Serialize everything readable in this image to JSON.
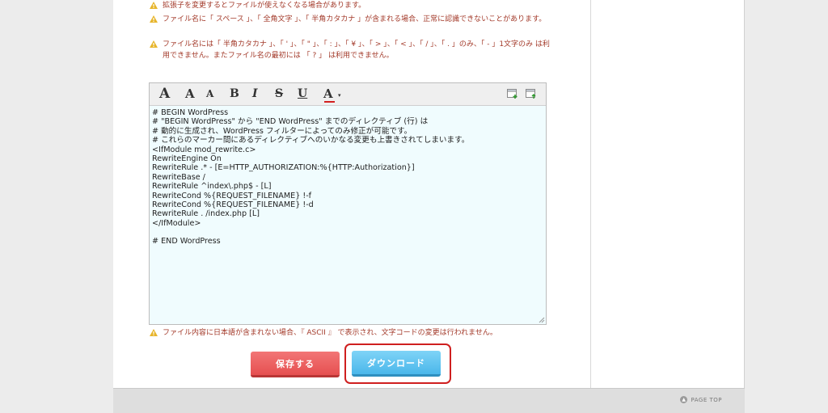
{
  "notes": [
    "拡張子を変更するとファイルが使えなくなる場合があります。",
    "ファイル名に「 スペース 」、「 全角文字 」、「 半角カタカナ 」が含まれる場合、正常に認識できないことがあります。",
    "ファイル名には「 半角カタカナ 」、「 ' 」、「 \" 」、「 : 」、「 ¥ 」、「 > 」、「 < 」、「 / 」、「 . 」のみ、「 - 」1文字のみ は利用できません。またファイル名の最初には 「 ? 」 は利用できません。"
  ],
  "toolbar": {
    "font_large": "A",
    "font_medium": "A",
    "font_small": "A",
    "bold": "B",
    "italic": "I",
    "strike": "S",
    "underline": "U",
    "color": "A",
    "caret": "▾"
  },
  "editor": {
    "lines": [
      "# BEGIN WordPress",
      "# \"BEGIN WordPress\" から \"END WordPress\" までのディレクティブ (行) は",
      "# 動的に生成され、WordPress フィルターによってのみ修正が可能です。",
      "# これらのマーカー間にあるディレクティブへのいかなる変更も上書きされてしまいます。",
      "<IfModule mod_rewrite.c>",
      "RewriteEngine On",
      "RewriteRule .* - [E=HTTP_AUTHORIZATION:%{HTTP:Authorization}]",
      "RewriteBase /",
      "RewriteRule ^index\\.php$ - [L]",
      "RewriteCond %{REQUEST_FILENAME} !-f",
      "RewriteCond %{REQUEST_FILENAME} !-d",
      "RewriteRule . /index.php [L]",
      "</IfModule>",
      "",
      "# END WordPress"
    ]
  },
  "bottom_note": "ファイル内容に日本語が含まれない場合、『 ASCII 』 で表示され、文字コードの変更は行われません。",
  "buttons": {
    "save": "保存する",
    "download": "ダウンロード"
  },
  "footer": {
    "page_top": "PAGE TOP",
    "page_top_icon": "▲"
  },
  "colors": {
    "note_text": "#a33a2a",
    "save_button": "#e64f50",
    "download_button": "#4ab7ea",
    "highlight": "#cf1f1f",
    "editor_bg": "#f0fcfe"
  }
}
